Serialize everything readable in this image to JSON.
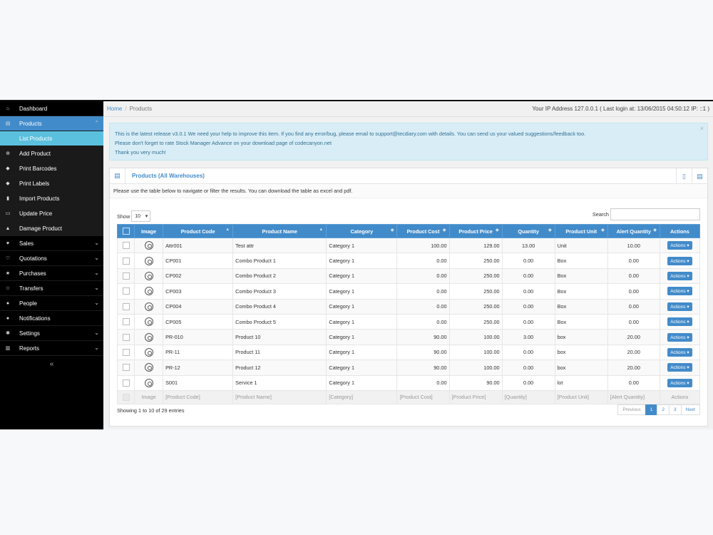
{
  "sidebar": {
    "items": [
      {
        "label": "Dashboard",
        "icon": "dashboard-icon",
        "glyph": "⌂",
        "chevron": ""
      },
      {
        "label": "Products",
        "icon": "barcode-icon",
        "glyph": "▤",
        "chevron": "⌃"
      },
      {
        "label": "List Products",
        "icon": "",
        "glyph": "",
        "chevron": ""
      },
      {
        "label": "Add Product",
        "icon": "plus-circle-icon",
        "glyph": "⊕",
        "chevron": ""
      },
      {
        "label": "Print Barcodes",
        "icon": "tag-icon",
        "glyph": "◆",
        "chevron": ""
      },
      {
        "label": "Print Labels",
        "icon": "tag-icon",
        "glyph": "◆",
        "chevron": ""
      },
      {
        "label": "Import Products",
        "icon": "file-icon",
        "glyph": "▮",
        "chevron": ""
      },
      {
        "label": "Update Price",
        "icon": "money-icon",
        "glyph": "▭",
        "chevron": ""
      },
      {
        "label": "Damage Product",
        "icon": "flask-icon",
        "glyph": "▲",
        "chevron": ""
      },
      {
        "label": "Sales",
        "icon": "heart-icon",
        "glyph": "♥",
        "chevron": "⌄"
      },
      {
        "label": "Quotations",
        "icon": "heart-outline-icon",
        "glyph": "♡",
        "chevron": "⌄"
      },
      {
        "label": "Purchases",
        "icon": "star-icon",
        "glyph": "★",
        "chevron": "⌄"
      },
      {
        "label": "Transfers",
        "icon": "star-outline-icon",
        "glyph": "☆",
        "chevron": "⌄"
      },
      {
        "label": "People",
        "icon": "users-icon",
        "glyph": "●",
        "chevron": "⌄"
      },
      {
        "label": "Notifications",
        "icon": "info-circle-icon",
        "glyph": "●",
        "chevron": ""
      },
      {
        "label": "Settings",
        "icon": "gear-icon",
        "glyph": "✱",
        "chevron": "⌄"
      },
      {
        "label": "Reports",
        "icon": "bar-chart-icon",
        "glyph": "▥",
        "chevron": "⌄"
      }
    ],
    "collapse_glyph": "«"
  },
  "topbar": {
    "home": "Home",
    "separator": "/",
    "current": "Products",
    "ip_info": "Your IP Address 127.0.0.1 ( Last login at: 13/06/2015 04:50:12 IP: ::1 )"
  },
  "alert": {
    "line1": "This is the latest release v3.0.1 We need your help to improve this item. If you find any error/bug, please email to support@tecdiary.com with details. You can send us your valued suggestions/feedback too.",
    "line2": "Please don't forget to rate Stock Manager Advance on your download page of codecanyon.net",
    "line3": "Thank you very much!",
    "close": "×"
  },
  "panel": {
    "title": "Products (All Warehouses)",
    "intro": "Please use the table below to navigate or filter the results. You can download the table as excel and pdf."
  },
  "controls": {
    "show_label": "Show",
    "show_value": "10",
    "search_label": "Search"
  },
  "table": {
    "headers": [
      "Image",
      "Product Code",
      "Product Name",
      "Category",
      "Product Cost",
      "Product Price",
      "Quantity",
      "Product Unit",
      "Alert Quantity",
      "Actions"
    ],
    "rows": [
      [
        "Attr001",
        "Test attr",
        "Category 1",
        "100.00",
        "129.00",
        "13.00",
        "Unit",
        "10.00"
      ],
      [
        "CP001",
        "Combo Product 1",
        "Category 1",
        "0.00",
        "250.00",
        "0.00",
        "Box",
        "0.00"
      ],
      [
        "CP002",
        "Combo Product 2",
        "Category 1",
        "0.00",
        "250.00",
        "0.00",
        "Box",
        "0.00"
      ],
      [
        "CP003",
        "Combo Product 3",
        "Category 1",
        "0.00",
        "250.00",
        "0.00",
        "Box",
        "0.00"
      ],
      [
        "CP004",
        "Combo Product 4",
        "Category 1",
        "0.00",
        "250.00",
        "0.00",
        "Box",
        "0.00"
      ],
      [
        "CP005",
        "Combo Product 5",
        "Category 1",
        "0.00",
        "250.00",
        "0.00",
        "Box",
        "0.00"
      ],
      [
        "PR-010",
        "Product 10",
        "Category 1",
        "90.00",
        "100.00",
        "3.00",
        "box",
        "20.00"
      ],
      [
        "PR-11",
        "Product 11",
        "Category 1",
        "90.00",
        "100.00",
        "0.00",
        "box",
        "20.00"
      ],
      [
        "PR-12",
        "Product 12",
        "Category 1",
        "90.00",
        "100.00",
        "0.00",
        "box",
        "20.00"
      ],
      [
        "S001",
        "Service 1",
        "Category 1",
        "0.00",
        "90.00",
        "0.00",
        "lot",
        "0.00"
      ]
    ],
    "action_label": "Actions ▾",
    "footer": [
      "Image",
      "[Product Code]",
      "[Product Name]",
      "[Category]",
      "[Product Cost]",
      "[Product Price]",
      "[Quantity]",
      "[Product Unit]",
      "[Alert Quantity]",
      "Actions"
    ]
  },
  "pagination": {
    "info": "Showing 1 to 10 of 29 entries",
    "pages": [
      "Previous",
      "1",
      "2",
      "3",
      "Next"
    ]
  }
}
